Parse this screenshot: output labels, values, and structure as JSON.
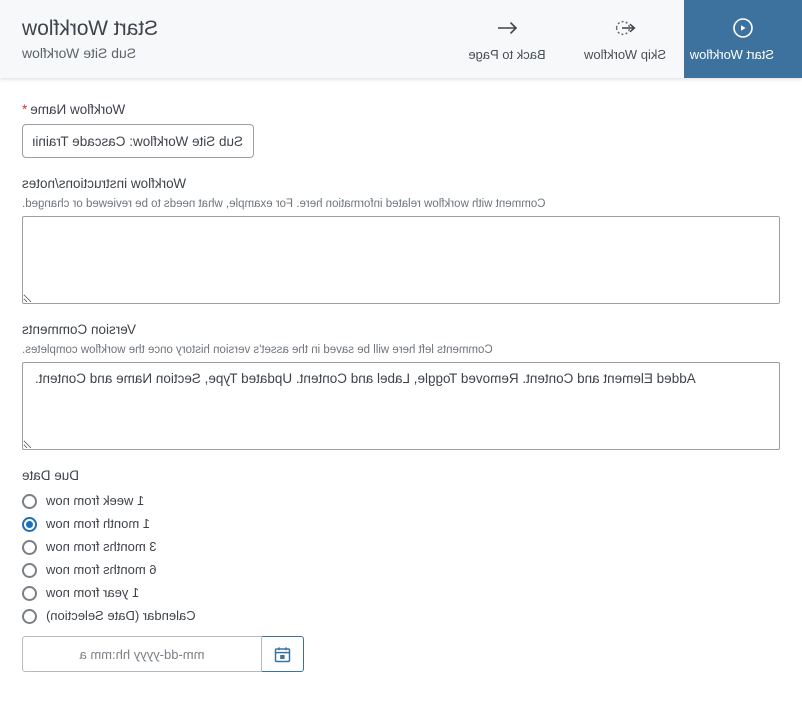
{
  "toolbar": {
    "items": [
      {
        "label": "Start Workflow",
        "icon": "play-circle-icon",
        "active": true
      },
      {
        "label": "Skip Workflow",
        "icon": "skip-workflow-icon",
        "active": false
      },
      {
        "label": "Back to Page",
        "icon": "arrow-left-icon",
        "active": false
      }
    ]
  },
  "header": {
    "title": "Start Workflow",
    "subtitle": "Sub Site Workflow"
  },
  "form": {
    "workflow_name": {
      "label": "Workflow Name",
      "required_marker": "*",
      "value": "Sub Site Workflow: Cascade Training"
    },
    "instructions": {
      "label": "Workflow instructions/notes",
      "help": "Comment with workflow related information here. For example, what needs to be reviewed or changed.",
      "value": ""
    },
    "version_comments": {
      "label": "Version Comments",
      "help": "Comments left here will be saved in the asset's version history once the workflow completes.",
      "value": "Added Element and Content. Removed Toggle, Label and Content. Updated Type, Section Name and Content."
    },
    "due_date": {
      "label": "Due Date",
      "options": [
        {
          "label": "1 week from now",
          "selected": false
        },
        {
          "label": "1 month from now",
          "selected": true
        },
        {
          "label": "3 months from now",
          "selected": false
        },
        {
          "label": "6 months from now",
          "selected": false
        },
        {
          "label": "1 year from now",
          "selected": false
        },
        {
          "label": "Calendar (Date Selection)",
          "selected": false
        }
      ],
      "date_input": {
        "placeholder": "mm-dd-yyyy hh:mm a",
        "value": "",
        "button_icon": "calendar-icon"
      }
    }
  },
  "colors": {
    "accent_blue": "#3d729f",
    "radio_blue": "#1d6fb8",
    "required_red": "#d9372b",
    "toolbar_bg": "#f7f8fa"
  }
}
